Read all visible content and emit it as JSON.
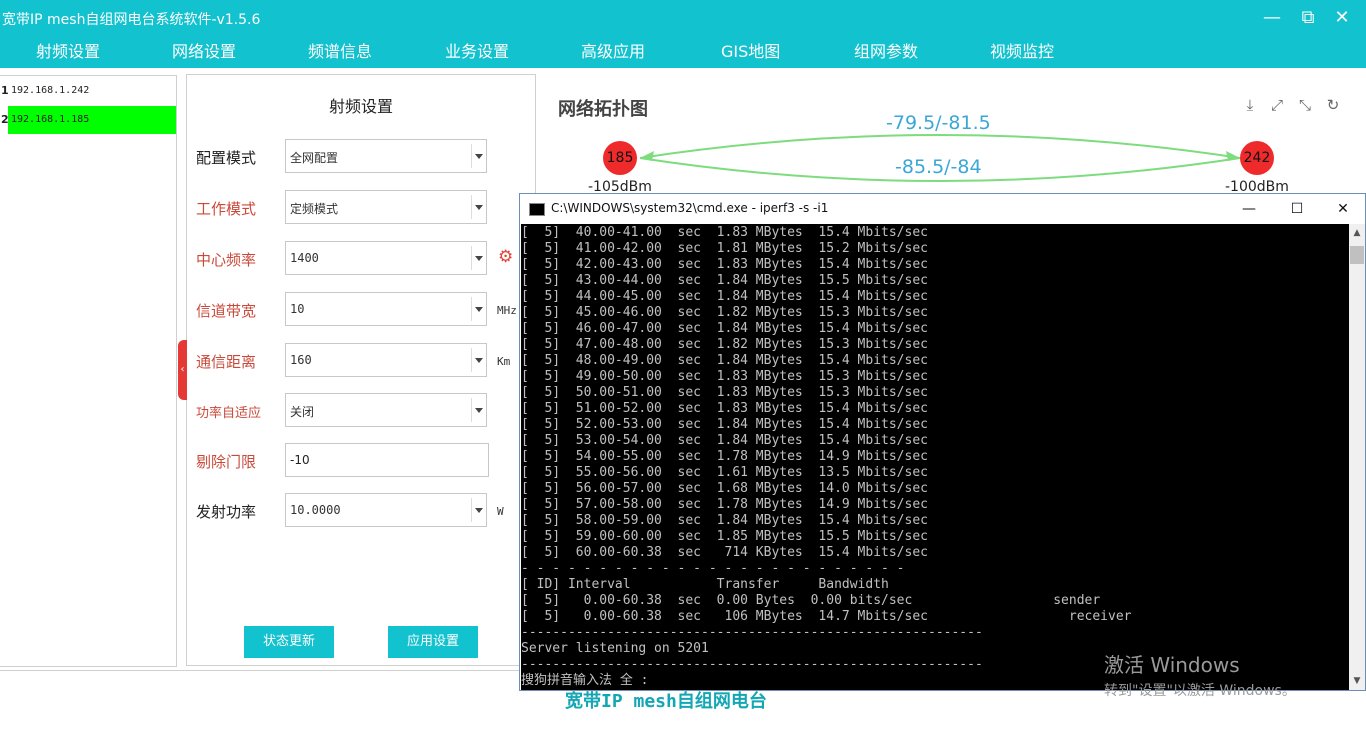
{
  "app": {
    "title": "宽带IP mesh自组网电台系统软件-v1.5.6",
    "window_controls": [
      "—",
      "⧉",
      "✕"
    ]
  },
  "menu": [
    "射频设置",
    "网络设置",
    "频谱信息",
    "业务设置",
    "高级应用",
    "GIS地图",
    "组网参数",
    "视频监控"
  ],
  "devices": [
    {
      "index": "1",
      "ip": "192.168.1.242",
      "selected": false
    },
    {
      "index": "2",
      "ip": "192.168.1.185",
      "selected": true
    }
  ],
  "rf": {
    "title": "射频设置",
    "fields": [
      {
        "label": "配置模式",
        "value": "全网配置",
        "unit": "",
        "kind": "select",
        "color": "black"
      },
      {
        "label": "工作模式",
        "value": "定频模式",
        "unit": "",
        "kind": "select",
        "color": "red"
      },
      {
        "label": "中心频率",
        "value": "1400",
        "unit": "",
        "kind": "select",
        "color": "red"
      },
      {
        "label": "信道带宽",
        "value": "10",
        "unit": "MHz",
        "kind": "select",
        "color": "red"
      },
      {
        "label": "通信距离",
        "value": "160",
        "unit": "Km",
        "kind": "select",
        "color": "red"
      },
      {
        "label": "功率自适应",
        "value": "关闭",
        "unit": "",
        "kind": "select",
        "color": "red"
      },
      {
        "label": "剔除门限",
        "value": "-10",
        "unit": "",
        "kind": "input",
        "color": "red"
      },
      {
        "label": "发射功率",
        "value": "10.0000",
        "unit": "W",
        "kind": "select",
        "color": "black"
      }
    ],
    "btn_status": "状态更新",
    "btn_apply": "应用设置"
  },
  "topology": {
    "title": "网络拓扑图",
    "node_a": {
      "id": "185",
      "signal": "-105dBm"
    },
    "node_b": {
      "id": "242",
      "signal": "-100dBm"
    },
    "link_top": "-79.5/-81.5",
    "link_bottom": "-85.5/-84"
  },
  "cmd": {
    "title": "C:\\WINDOWS\\system32\\cmd.exe - iperf3  -s -i1",
    "lines": [
      "[  5]  40.00-41.00  sec  1.83 MBytes  15.4 Mbits/sec",
      "[  5]  41.00-42.00  sec  1.81 MBytes  15.2 Mbits/sec",
      "[  5]  42.00-43.00  sec  1.83 MBytes  15.4 Mbits/sec",
      "[  5]  43.00-44.00  sec  1.84 MBytes  15.5 Mbits/sec",
      "[  5]  44.00-45.00  sec  1.84 MBytes  15.4 Mbits/sec",
      "[  5]  45.00-46.00  sec  1.82 MBytes  15.3 Mbits/sec",
      "[  5]  46.00-47.00  sec  1.84 MBytes  15.4 Mbits/sec",
      "[  5]  47.00-48.00  sec  1.82 MBytes  15.3 Mbits/sec",
      "[  5]  48.00-49.00  sec  1.84 MBytes  15.4 Mbits/sec",
      "[  5]  49.00-50.00  sec  1.83 MBytes  15.3 Mbits/sec",
      "[  5]  50.00-51.00  sec  1.83 MBytes  15.3 Mbits/sec",
      "[  5]  51.00-52.00  sec  1.83 MBytes  15.4 Mbits/sec",
      "[  5]  52.00-53.00  sec  1.84 MBytes  15.4 Mbits/sec",
      "[  5]  53.00-54.00  sec  1.84 MBytes  15.4 Mbits/sec",
      "[  5]  54.00-55.00  sec  1.78 MBytes  14.9 Mbits/sec",
      "[  5]  55.00-56.00  sec  1.61 MBytes  13.5 Mbits/sec",
      "[  5]  56.00-57.00  sec  1.68 MBytes  14.0 Mbits/sec",
      "[  5]  57.00-58.00  sec  1.78 MBytes  14.9 Mbits/sec",
      "[  5]  58.00-59.00  sec  1.84 MBytes  15.4 Mbits/sec",
      "[  5]  59.00-60.00  sec  1.85 MBytes  15.5 Mbits/sec",
      "[  5]  60.00-60.38  sec   714 KBytes  15.4 Mbits/sec",
      "- - - - - - - - - - - - - - - - - - - - - - - - -",
      "[ ID] Interval           Transfer     Bandwidth",
      "[  5]   0.00-60.38  sec  0.00 Bytes  0.00 bits/sec                  sender",
      "[  5]   0.00-60.38  sec   106 MBytes  14.7 Mbits/sec                  receiver",
      "-----------------------------------------------------------",
      "Server listening on 5201",
      "-----------------------------------------------------------",
      "搜狗拼音输入法 全 :"
    ]
  },
  "watermark": {
    "line1": "激活 Windows",
    "line2": "转到\"设置\"以激活 Windows。"
  },
  "bottom_text": "宽带IP mesh自组网电台",
  "colors": {
    "accent": "#13c2cf",
    "selected_row": "#00ff00",
    "node": "#ef2a2a",
    "link": "#7ddc7d",
    "link_label": "#3aa7d6"
  },
  "icons": [
    "download-icon",
    "expand-icon",
    "compress-icon",
    "refresh-icon",
    "gear-icon",
    "chevron-left-icon",
    "cmd-icon"
  ]
}
